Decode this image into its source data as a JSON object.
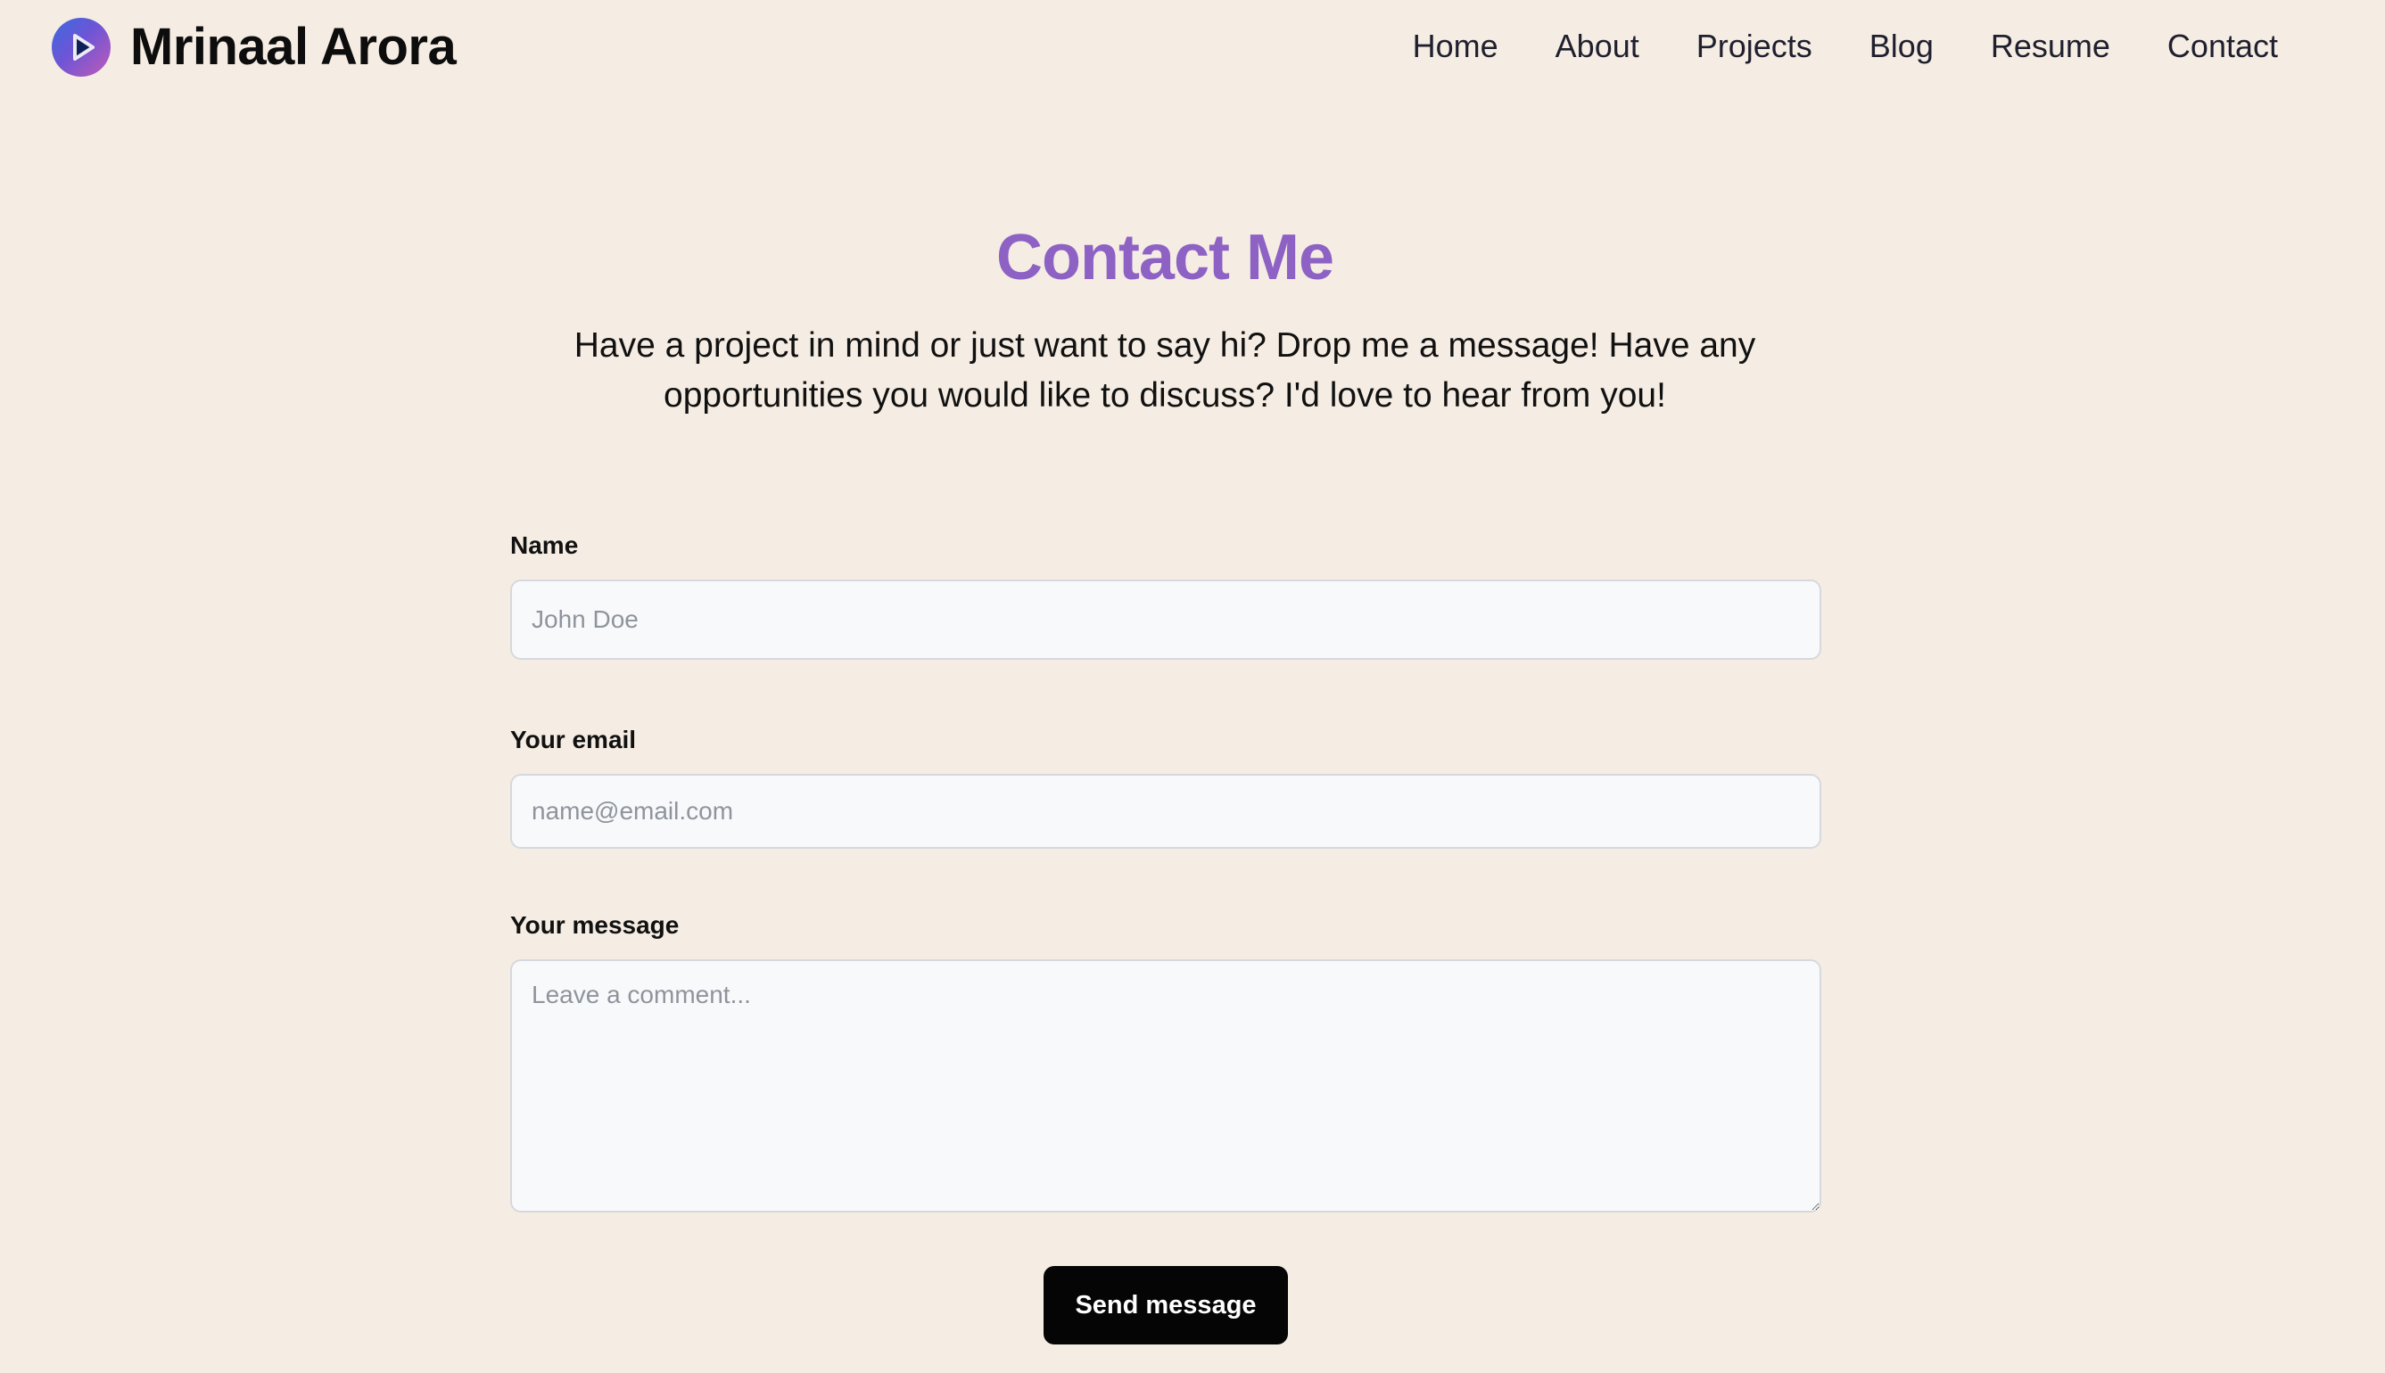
{
  "header": {
    "brand": "Mrinaal Arora",
    "logo_icon": "play-icon",
    "nav": [
      {
        "label": "Home"
      },
      {
        "label": "About"
      },
      {
        "label": "Projects"
      },
      {
        "label": "Blog"
      },
      {
        "label": "Resume"
      },
      {
        "label": "Contact"
      }
    ]
  },
  "main": {
    "title": "Contact Me",
    "intro": "Have a project in mind or just want to say hi? Drop me a message! Have any opportunities you would like to discuss? I'd love to hear from you!"
  },
  "form": {
    "name": {
      "label": "Name",
      "placeholder": "John Doe",
      "value": ""
    },
    "email": {
      "label": "Your email",
      "placeholder": "name@email.com",
      "value": ""
    },
    "message": {
      "label": "Your message",
      "placeholder": "Leave a comment...",
      "value": ""
    },
    "submit_label": "Send message"
  },
  "colors": {
    "background": "#f5ede3",
    "title": "#8d62c4",
    "button": "#050505",
    "input_background": "#f8f9fb"
  }
}
